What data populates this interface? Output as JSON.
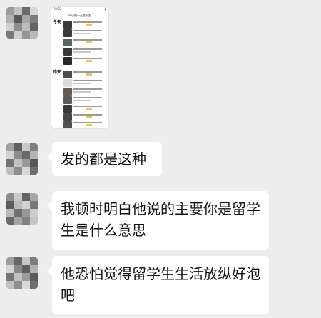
{
  "messages": [
    {
      "type": "image",
      "content": "screenshot of a post list"
    },
    {
      "type": "text",
      "text": "发的都是这种"
    },
    {
      "type": "text",
      "text": "我顿时明白他说的主要你是留学生是什么意思"
    },
    {
      "type": "text",
      "text": "他恐怕觉得留学生生活放纵好泡吧"
    }
  ],
  "screenshot": {
    "status_time": "09:23",
    "title": "四小美一天要早起",
    "day_today": "今天",
    "day_yesterday": "昨天"
  },
  "colors": {
    "chat_background": "#ededed",
    "bubble": "#ffffff",
    "avatar_tiles": [
      "#8a8a8a",
      "#b5b5b5",
      "#5f5f5f",
      "#d2d2d2",
      "#a0a0a0",
      "#6e6e6e"
    ]
  }
}
